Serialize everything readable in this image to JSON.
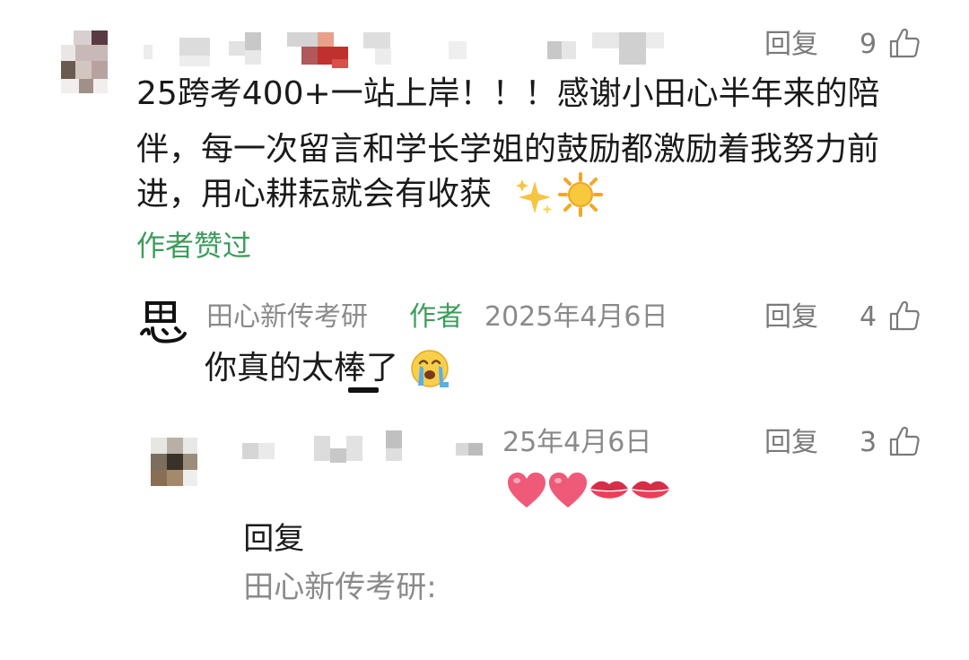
{
  "comment1": {
    "text_lines": [
      "25跨考400+一站上岸！！！感谢小田心半年来的陪",
      "伴，每一次留言和学长学姐的鼓励都激励着我努力前",
      "进，用心耕耘就会有收获"
    ],
    "emojis": [
      "sparkles-emoji",
      "sun-emoji"
    ],
    "author_liked": "作者赞过",
    "reply_label": "回复",
    "like_count": "9"
  },
  "reply1": {
    "name": "田心新传考研",
    "badge": "作者",
    "date": "2025年4月6日",
    "text": "你真的太棒了",
    "emoji": "crying-face-emoji",
    "reply_label": "回复",
    "like_count": "4"
  },
  "reply2": {
    "date_visible": "25年4月6日",
    "prefix": "回复",
    "target": "田心新传考研:",
    "emojis": [
      "heart-emoji",
      "heart-emoji",
      "lips-emoji",
      "lips-emoji"
    ],
    "reply_label": "回复",
    "like_count": "3"
  },
  "colors": {
    "accent_green": "#3c9c5c",
    "meta_gray": "#8a8a8a"
  }
}
